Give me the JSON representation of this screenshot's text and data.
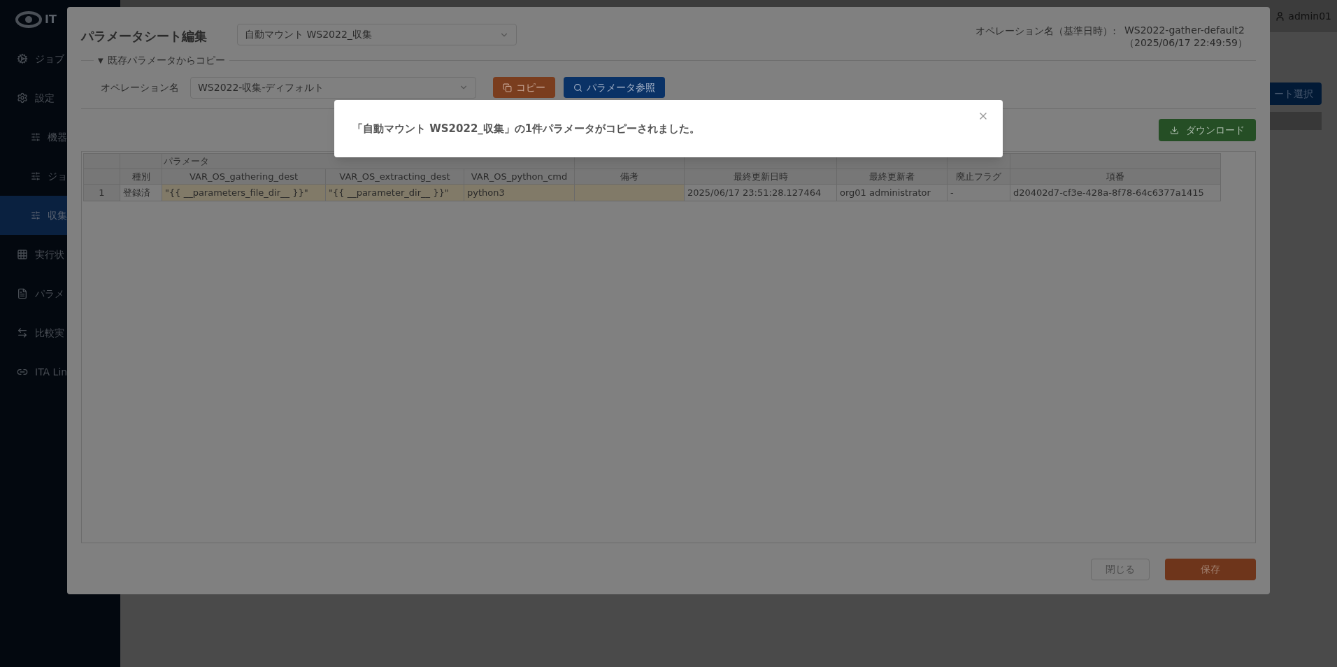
{
  "app": {
    "logo": "IT",
    "user": "admin01"
  },
  "sidebar": {
    "items": [
      {
        "label": "ジョブ",
        "kind": "main",
        "selected": false
      },
      {
        "label": "設定",
        "kind": "main",
        "selected": false
      },
      {
        "label": "機器",
        "kind": "sub",
        "selected": false
      },
      {
        "label": "ジョ",
        "kind": "sub",
        "selected": false
      },
      {
        "label": "収集",
        "kind": "sub",
        "selected": true
      },
      {
        "label": "実行状",
        "kind": "main",
        "selected": false
      },
      {
        "label": "パラメ",
        "kind": "main",
        "selected": false
      },
      {
        "label": "比較実",
        "kind": "main",
        "selected": false
      },
      {
        "label": "ITA Lin",
        "kind": "main",
        "selected": false
      }
    ]
  },
  "background": {
    "button": "ート選択"
  },
  "dialog": {
    "title": "パラメータシート編集",
    "sheet_select": "自動マウント WS2022_収集",
    "operation_label": "オペレーション名（基準日時）:",
    "operation_name": "WS2022-gather-default2",
    "operation_date": "（2025/06/17 22:49:59）",
    "copy_section": {
      "toggle": "▼",
      "legend": "既存パラメータからコピー",
      "label": "オペレーション名",
      "select": "WS2022-収集-ディフォルト",
      "copy_button": "コピー",
      "ref_button": "パラメータ参照"
    },
    "download_button": "ダウンロード",
    "table": {
      "group_header": "パラメータ",
      "columns": [
        "",
        "種別",
        "VAR_OS_gathering_dest",
        "VAR_OS_extracting_dest",
        "VAR_OS_python_cmd",
        "備考",
        "最終更新日時",
        "最終更新者",
        "廃止フラグ",
        "項番"
      ],
      "rows": [
        [
          "1",
          "登録済",
          "\"{{ __parameters_file_dir__ }}\"",
          "\"{{ __parameter_dir__ }}\"",
          "python3",
          "",
          "2025/06/17 23:51:28.127464",
          "org01 administrator",
          "-",
          "d20402d7-cf3e-428a-8f78-64c6377a1415"
        ]
      ]
    },
    "close_button": "閉じる",
    "save_button": "保存"
  },
  "toast": {
    "message": "「自動マウント WS2022_収集」の1件パラメータがコピーされました。"
  }
}
